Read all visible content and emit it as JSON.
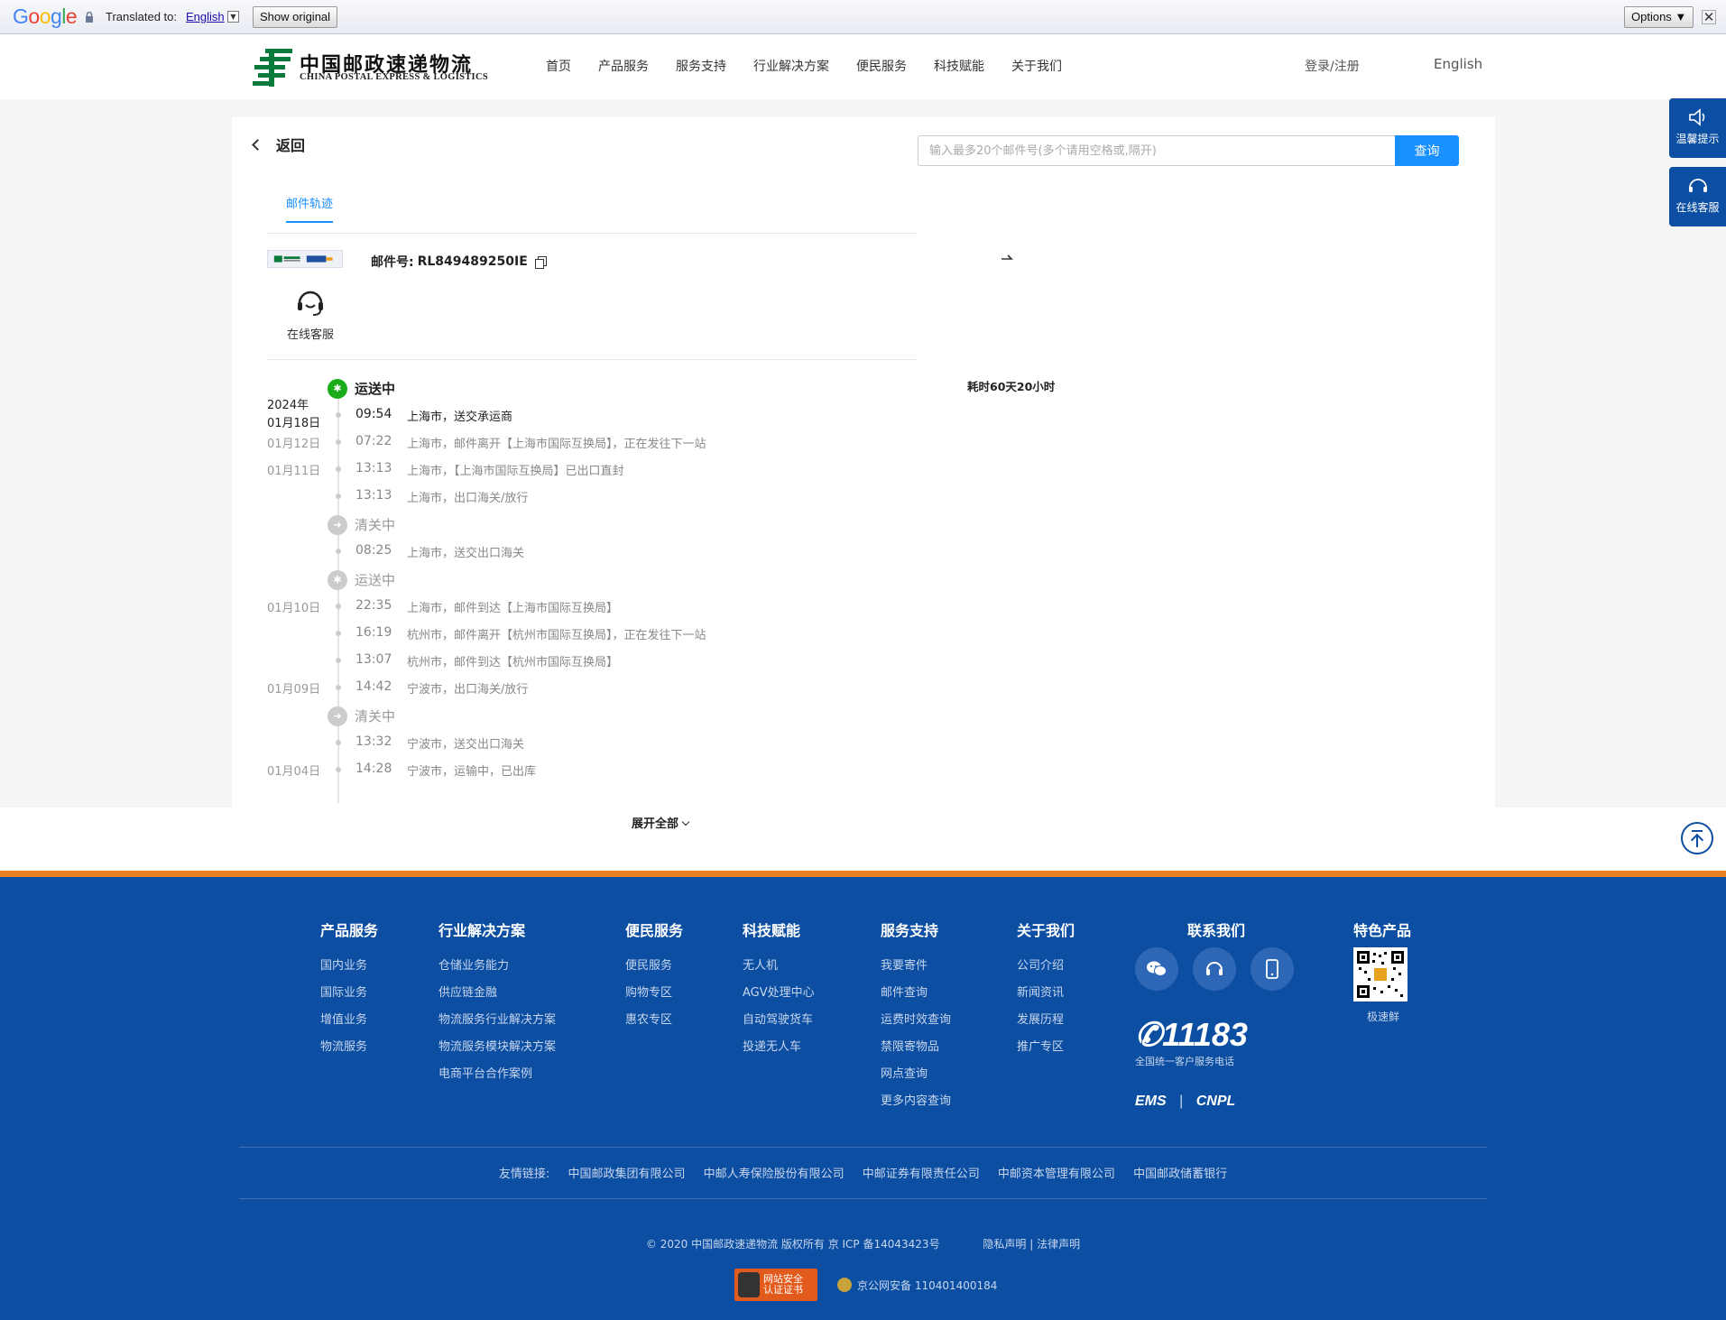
{
  "translate_bar": {
    "logo": "Google",
    "translated_to": "Translated to:",
    "language": "English",
    "show_original": "Show original",
    "options": "Options ▼",
    "close": "✕"
  },
  "header": {
    "logo_cn": "中国邮政速递物流",
    "logo_en": "CHINA POSTAL EXPRESS & LOGISTICS",
    "nav": [
      "首页",
      "产品服务",
      "服务支持",
      "行业解决方案",
      "便民服务",
      "科技赋能",
      "关于我们"
    ],
    "login": "登录/注册",
    "language": "English"
  },
  "page": {
    "back": "返回",
    "search_placeholder": "输入最多20个邮件号(多个请用空格或,隔开)",
    "search_button": "查询",
    "tab": "邮件轨迹",
    "mail_label": "邮件号:",
    "mail_number": "RL849489250IE",
    "customer_service": "在线客服",
    "elapsed": "耗时60天20小时",
    "year": "2024年",
    "first_date": "01月18日",
    "expand_all": "展开全部"
  },
  "timeline": [
    {
      "type": "status",
      "label": "运送中",
      "active": true
    },
    {
      "type": "event",
      "date": "",
      "time": "09:54",
      "desc": "上海市，送交承运商",
      "active": true
    },
    {
      "type": "event",
      "date": "01月12日",
      "time": "07:22",
      "desc": "上海市，邮件离开【上海市国际互换局】，正在发往下一站"
    },
    {
      "type": "event",
      "date": "01月11日",
      "time": "13:13",
      "desc": "上海市，【上海市国际互换局】已出口直封"
    },
    {
      "type": "event",
      "date": "",
      "time": "13:13",
      "desc": "上海市，出口海关/放行"
    },
    {
      "type": "status",
      "label": "清关中"
    },
    {
      "type": "event",
      "date": "",
      "time": "08:25",
      "desc": "上海市，送交出口海关"
    },
    {
      "type": "status",
      "label": "运送中"
    },
    {
      "type": "event",
      "date": "01月10日",
      "time": "22:35",
      "desc": "上海市，邮件到达【上海市国际互换局】"
    },
    {
      "type": "event",
      "date": "",
      "time": "16:19",
      "desc": "杭州市，邮件离开【杭州市国际互换局】，正在发往下一站"
    },
    {
      "type": "event",
      "date": "",
      "time": "13:07",
      "desc": "杭州市，邮件到达【杭州市国际互换局】"
    },
    {
      "type": "event",
      "date": "01月09日",
      "time": "14:42",
      "desc": "宁波市，出口海关/放行"
    },
    {
      "type": "status",
      "label": "清关中"
    },
    {
      "type": "event",
      "date": "",
      "time": "13:32",
      "desc": "宁波市，送交出口海关"
    },
    {
      "type": "event",
      "date": "01月04日",
      "time": "14:28",
      "desc": "宁波市，运输中，已出库"
    }
  ],
  "floats": {
    "notice": "温馨提示",
    "service": "在线客服"
  },
  "footer": {
    "columns": [
      {
        "title": "产品服务",
        "links": [
          "国内业务",
          "国际业务",
          "增值业务",
          "物流服务"
        ]
      },
      {
        "title": "行业解决方案",
        "links": [
          "仓储业务能力",
          "供应链金融",
          "物流服务行业解决方案",
          "物流服务模块解决方案",
          "电商平台合作案例"
        ]
      },
      {
        "title": "便民服务",
        "links": [
          "便民服务",
          "购物专区",
          "惠农专区"
        ]
      },
      {
        "title": "科技赋能",
        "links": [
          "无人机",
          "AGV处理中心",
          "自动驾驶货车",
          "投递无人车"
        ]
      },
      {
        "title": "服务支持",
        "links": [
          "我要寄件",
          "邮件查询",
          "运费时效查询",
          "禁限寄物品",
          "网点查询",
          "更多内容查询"
        ]
      },
      {
        "title": "关于我们",
        "links": [
          "公司介绍",
          "新闻资讯",
          "发展历程",
          "推广专区"
        ]
      }
    ],
    "contact_title": "联系我们",
    "hotline": "11183",
    "hotline_sub": "全国统一客户服务电话",
    "brand_ems": "EMS",
    "brand_cnpl": "CNPL",
    "featured_title": "特色产品",
    "featured_label": "极速鲜",
    "friends_label": "友情链接:",
    "friends": [
      "中国邮政集团有限公司",
      "中邮人寿保险股份有限公司",
      "中邮证券有限责任公司",
      "中邮资本管理有限公司",
      "中国邮政储蓄银行"
    ],
    "copyright": "© 2020 中国邮政速递物流 版权所有 京 ICP 备14043423号",
    "privacy": "隐私声明 | 法律声明",
    "secure_badge": "网站安全 认证证书",
    "beian": "京公网安备 110401400184"
  }
}
